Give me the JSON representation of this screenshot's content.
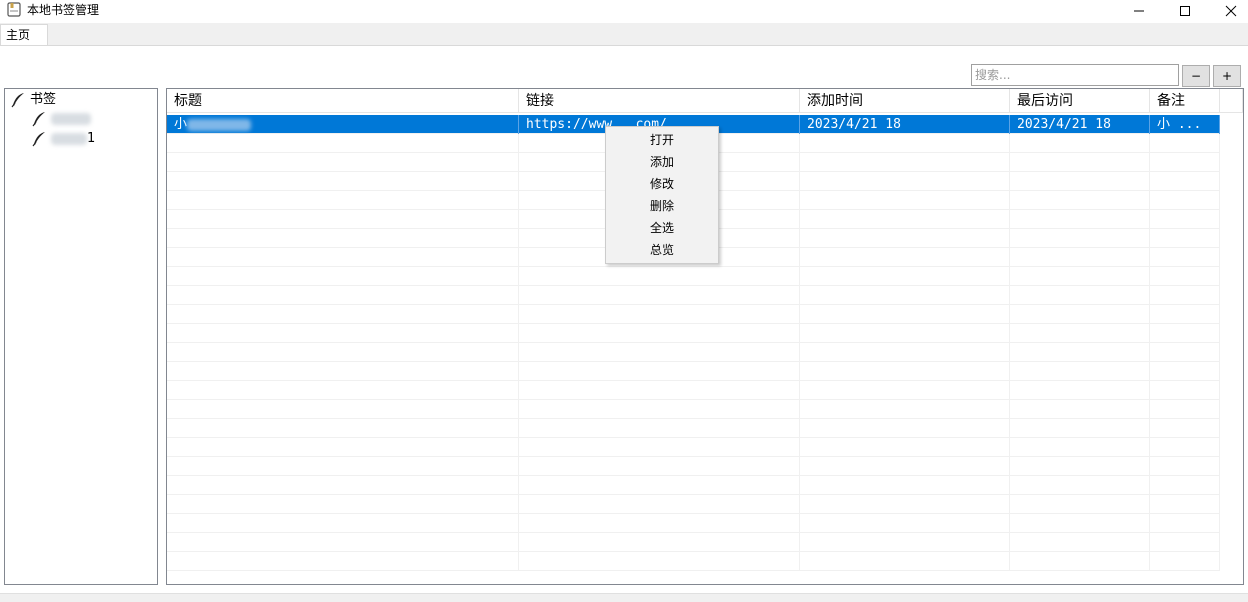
{
  "window": {
    "title": "本地书签管理",
    "icon": "notebook-icon",
    "controls": [
      "minimize-icon",
      "maximize-icon",
      "close-icon"
    ]
  },
  "tabs": [
    {
      "label": "主页",
      "active": true
    }
  ],
  "search": {
    "placeholder": "搜索...",
    "value": ""
  },
  "buttons": {
    "minus": "−",
    "plus": "+"
  },
  "tree": {
    "root": {
      "label": "书签",
      "icon": "quill-icon"
    },
    "children": [
      {
        "label": "",
        "icon": "quill-icon",
        "obscured": true
      },
      {
        "label": "1",
        "icon": "quill-icon",
        "obscured": true
      }
    ]
  },
  "grid": {
    "columns": [
      "标题",
      "链接",
      "添加时间",
      "最后访问",
      "备注"
    ],
    "rows": [
      {
        "title": "小",
        "link": "https://www.       .com/",
        "added": "2023/4/21 18",
        "visited": "2023/4/21 18",
        "note": "小   ...",
        "selected": true
      }
    ]
  },
  "context_menu": {
    "items": [
      "打开",
      "添加",
      "修改",
      "删除",
      "全选",
      "总览"
    ]
  },
  "colors": {
    "selection": "#0078d7",
    "menu_bg": "#f2f2f2",
    "border": "#828790"
  }
}
